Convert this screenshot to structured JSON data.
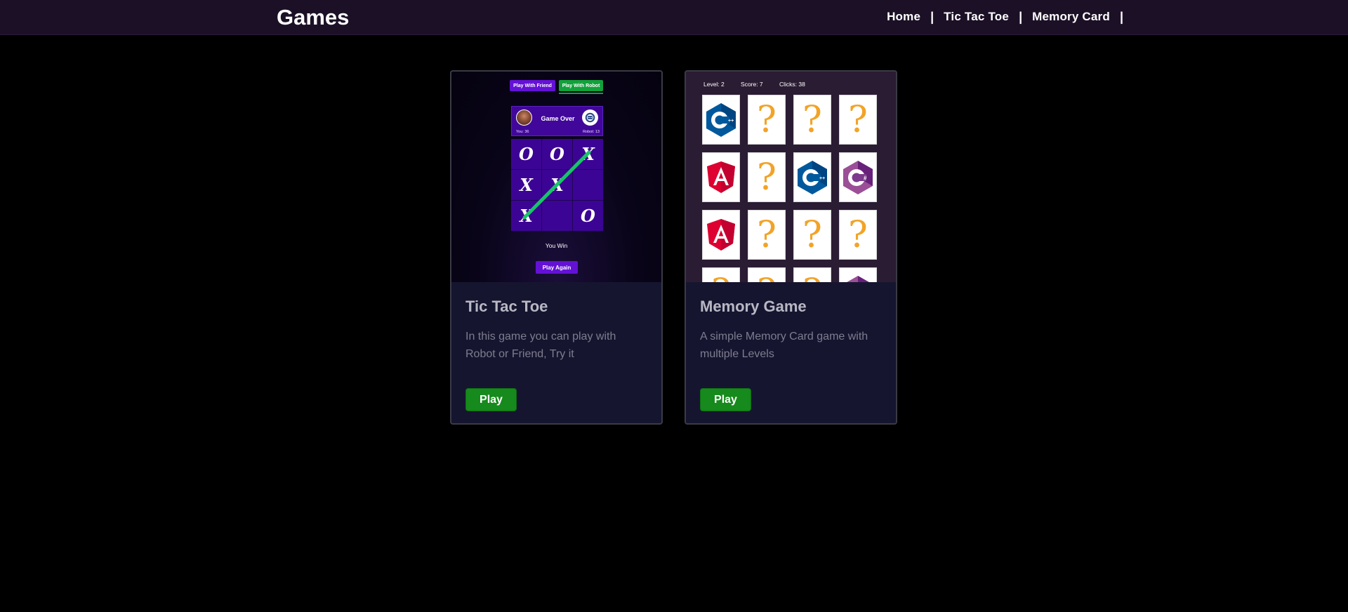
{
  "header": {
    "brand": "Games",
    "nav": [
      "Home",
      "Tic Tac Toe",
      "Memory Card"
    ],
    "separator": "|"
  },
  "cards": [
    {
      "title": "Tic Tac Toe",
      "description": "In this game you can play with Robot or Friend, Try it",
      "button": "Play",
      "preview": {
        "mode_friend": "Play With Friend",
        "mode_robot": "Play With Robot",
        "status": "Game Over",
        "you_score": "You: 36",
        "robot_score": "Robot: 13",
        "board": [
          "O",
          "O",
          "X",
          "X",
          "X",
          "",
          "X",
          "",
          "O"
        ],
        "result": "You Win",
        "play_again": "Play Again"
      }
    },
    {
      "title": "Memory Game",
      "description": "A simple Memory Card game with multiple Levels",
      "button": "Play",
      "preview": {
        "level": "Level: 2",
        "score": "Score: 7",
        "clicks": "Clicks: 38",
        "cards": [
          "cpp",
          "hidden",
          "hidden",
          "hidden",
          "angular",
          "hidden",
          "cpp",
          "csharp",
          "angular",
          "hidden",
          "hidden",
          "hidden",
          "hidden",
          "hidden",
          "hidden",
          "csharp"
        ]
      }
    }
  ],
  "colors": {
    "navbar": "#1c1026",
    "card": "#161530",
    "play_button": "#168a1c",
    "ttt_purple": "#6411d6",
    "ttt_green": "#12a13b",
    "question_mark": "#f2a327"
  }
}
